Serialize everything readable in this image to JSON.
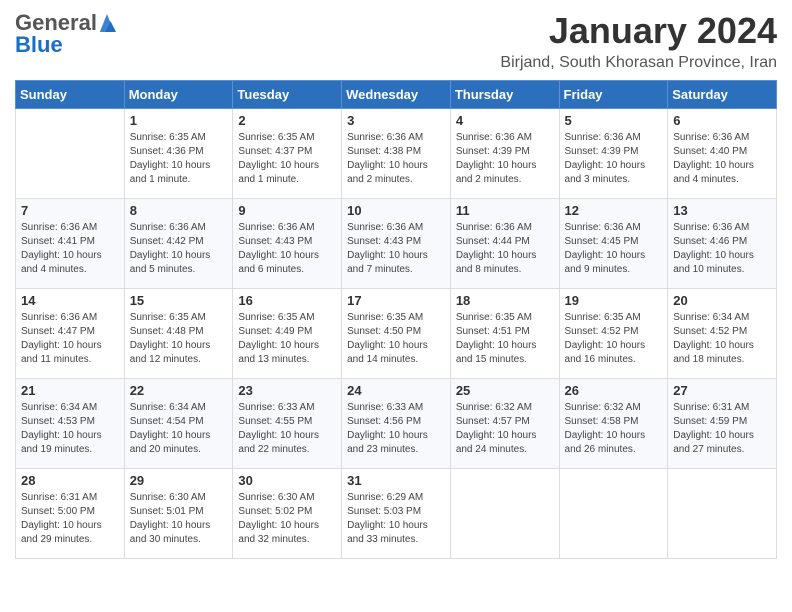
{
  "header": {
    "logo_general": "General",
    "logo_blue": "Blue",
    "month_title": "January 2024",
    "subtitle": "Birjand, South Khorasan Province, Iran"
  },
  "days_of_week": [
    "Sunday",
    "Monday",
    "Tuesday",
    "Wednesday",
    "Thursday",
    "Friday",
    "Saturday"
  ],
  "weeks": [
    [
      {
        "day": "",
        "info": ""
      },
      {
        "day": "1",
        "info": "Sunrise: 6:35 AM\nSunset: 4:36 PM\nDaylight: 10 hours\nand 1 minute."
      },
      {
        "day": "2",
        "info": "Sunrise: 6:35 AM\nSunset: 4:37 PM\nDaylight: 10 hours\nand 1 minute."
      },
      {
        "day": "3",
        "info": "Sunrise: 6:36 AM\nSunset: 4:38 PM\nDaylight: 10 hours\nand 2 minutes."
      },
      {
        "day": "4",
        "info": "Sunrise: 6:36 AM\nSunset: 4:39 PM\nDaylight: 10 hours\nand 2 minutes."
      },
      {
        "day": "5",
        "info": "Sunrise: 6:36 AM\nSunset: 4:39 PM\nDaylight: 10 hours\nand 3 minutes."
      },
      {
        "day": "6",
        "info": "Sunrise: 6:36 AM\nSunset: 4:40 PM\nDaylight: 10 hours\nand 4 minutes."
      }
    ],
    [
      {
        "day": "7",
        "info": "Sunrise: 6:36 AM\nSunset: 4:41 PM\nDaylight: 10 hours\nand 4 minutes."
      },
      {
        "day": "8",
        "info": "Sunrise: 6:36 AM\nSunset: 4:42 PM\nDaylight: 10 hours\nand 5 minutes."
      },
      {
        "day": "9",
        "info": "Sunrise: 6:36 AM\nSunset: 4:43 PM\nDaylight: 10 hours\nand 6 minutes."
      },
      {
        "day": "10",
        "info": "Sunrise: 6:36 AM\nSunset: 4:43 PM\nDaylight: 10 hours\nand 7 minutes."
      },
      {
        "day": "11",
        "info": "Sunrise: 6:36 AM\nSunset: 4:44 PM\nDaylight: 10 hours\nand 8 minutes."
      },
      {
        "day": "12",
        "info": "Sunrise: 6:36 AM\nSunset: 4:45 PM\nDaylight: 10 hours\nand 9 minutes."
      },
      {
        "day": "13",
        "info": "Sunrise: 6:36 AM\nSunset: 4:46 PM\nDaylight: 10 hours\nand 10 minutes."
      }
    ],
    [
      {
        "day": "14",
        "info": "Sunrise: 6:36 AM\nSunset: 4:47 PM\nDaylight: 10 hours\nand 11 minutes."
      },
      {
        "day": "15",
        "info": "Sunrise: 6:35 AM\nSunset: 4:48 PM\nDaylight: 10 hours\nand 12 minutes."
      },
      {
        "day": "16",
        "info": "Sunrise: 6:35 AM\nSunset: 4:49 PM\nDaylight: 10 hours\nand 13 minutes."
      },
      {
        "day": "17",
        "info": "Sunrise: 6:35 AM\nSunset: 4:50 PM\nDaylight: 10 hours\nand 14 minutes."
      },
      {
        "day": "18",
        "info": "Sunrise: 6:35 AM\nSunset: 4:51 PM\nDaylight: 10 hours\nand 15 minutes."
      },
      {
        "day": "19",
        "info": "Sunrise: 6:35 AM\nSunset: 4:52 PM\nDaylight: 10 hours\nand 16 minutes."
      },
      {
        "day": "20",
        "info": "Sunrise: 6:34 AM\nSunset: 4:52 PM\nDaylight: 10 hours\nand 18 minutes."
      }
    ],
    [
      {
        "day": "21",
        "info": "Sunrise: 6:34 AM\nSunset: 4:53 PM\nDaylight: 10 hours\nand 19 minutes."
      },
      {
        "day": "22",
        "info": "Sunrise: 6:34 AM\nSunset: 4:54 PM\nDaylight: 10 hours\nand 20 minutes."
      },
      {
        "day": "23",
        "info": "Sunrise: 6:33 AM\nSunset: 4:55 PM\nDaylight: 10 hours\nand 22 minutes."
      },
      {
        "day": "24",
        "info": "Sunrise: 6:33 AM\nSunset: 4:56 PM\nDaylight: 10 hours\nand 23 minutes."
      },
      {
        "day": "25",
        "info": "Sunrise: 6:32 AM\nSunset: 4:57 PM\nDaylight: 10 hours\nand 24 minutes."
      },
      {
        "day": "26",
        "info": "Sunrise: 6:32 AM\nSunset: 4:58 PM\nDaylight: 10 hours\nand 26 minutes."
      },
      {
        "day": "27",
        "info": "Sunrise: 6:31 AM\nSunset: 4:59 PM\nDaylight: 10 hours\nand 27 minutes."
      }
    ],
    [
      {
        "day": "28",
        "info": "Sunrise: 6:31 AM\nSunset: 5:00 PM\nDaylight: 10 hours\nand 29 minutes."
      },
      {
        "day": "29",
        "info": "Sunrise: 6:30 AM\nSunset: 5:01 PM\nDaylight: 10 hours\nand 30 minutes."
      },
      {
        "day": "30",
        "info": "Sunrise: 6:30 AM\nSunset: 5:02 PM\nDaylight: 10 hours\nand 32 minutes."
      },
      {
        "day": "31",
        "info": "Sunrise: 6:29 AM\nSunset: 5:03 PM\nDaylight: 10 hours\nand 33 minutes."
      },
      {
        "day": "",
        "info": ""
      },
      {
        "day": "",
        "info": ""
      },
      {
        "day": "",
        "info": ""
      }
    ]
  ]
}
